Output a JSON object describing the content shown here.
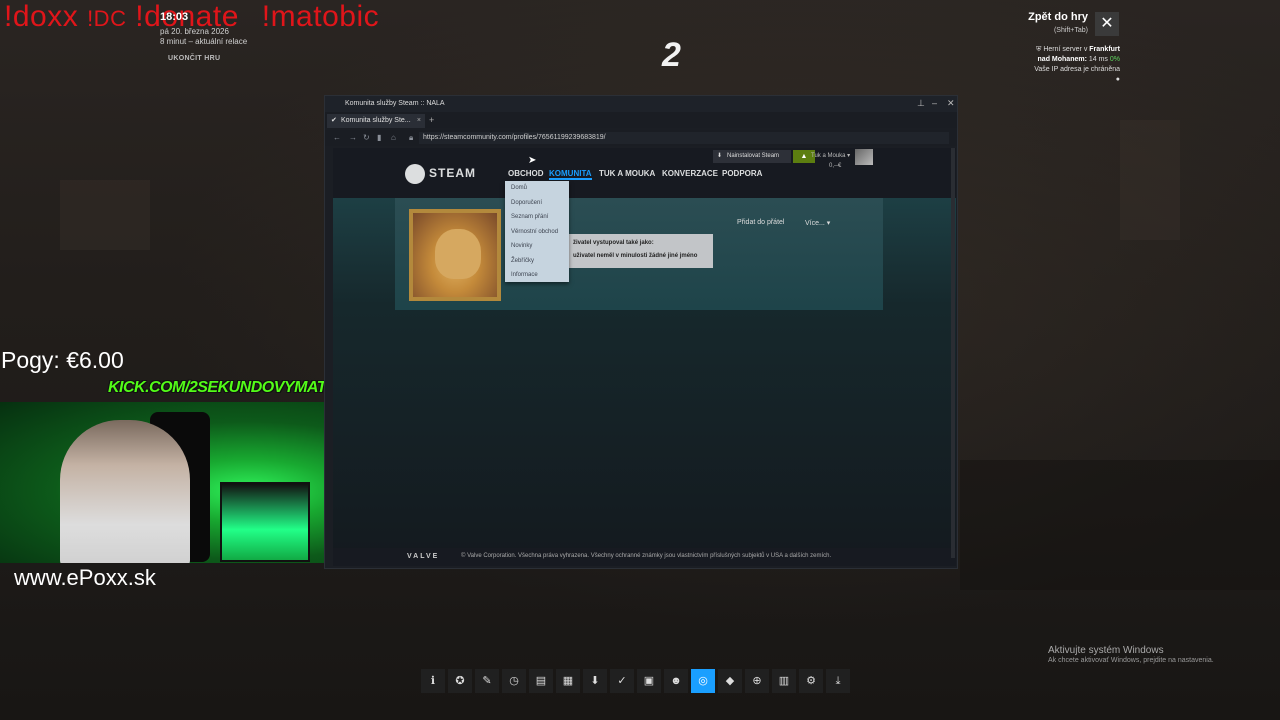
{
  "overlay": {
    "stream_cmds": {
      "doxx": "!doxx",
      "dc": "!DC",
      "donate": "!donate",
      "matobic": "!matobic"
    },
    "clock": "18:03",
    "date": "pá 20. března 2026",
    "session": "8 minut – aktuální relace",
    "end_game": "UKONČIT HRU",
    "back_to_game": "Zpět do hry",
    "back_hint": "(Shift+Tab)",
    "close_icon": "✕",
    "server": {
      "line1_prefix": "Herní server v ",
      "line1_city": "Frankfurt",
      "line2_city": "nad Mohanem:",
      "line2_ping": " 14 ms ",
      "line2_loss": "0%",
      "line3": "Vaše IP adresa je chráněna"
    },
    "pogy": "Pogy: €6.00",
    "kick": "KICK.COM/2SEKUNDOVYMATO",
    "website": "www.ePoxx.sk",
    "cs2_logo": "2",
    "windows_activate": "Aktivujte systém Windows",
    "windows_activate_sub": "Ak chcete aktivovať Windows, prejdite na nastavenia."
  },
  "toolbar": {
    "icons": [
      {
        "name": "info-icon",
        "glyph": "ℹ"
      },
      {
        "name": "achievements-icon",
        "glyph": "✪"
      },
      {
        "name": "edit-icon",
        "glyph": "✎"
      },
      {
        "name": "clock-icon",
        "glyph": "◷"
      },
      {
        "name": "notes-icon",
        "glyph": "▤"
      },
      {
        "name": "chat-icon",
        "glyph": "▦"
      },
      {
        "name": "download-icon",
        "glyph": "⬇"
      },
      {
        "name": "wrench-icon",
        "glyph": "✓"
      },
      {
        "name": "screenshot-icon",
        "glyph": "▣"
      },
      {
        "name": "friends-icon",
        "glyph": "☻"
      },
      {
        "name": "browser-icon",
        "glyph": "◎"
      },
      {
        "name": "controller-icon",
        "glyph": "◆"
      },
      {
        "name": "globe-icon",
        "glyph": "⊕"
      },
      {
        "name": "recording-icon",
        "glyph": "▥"
      },
      {
        "name": "settings-icon",
        "glyph": "⚙"
      },
      {
        "name": "minimize-icon",
        "glyph": "⤓"
      }
    ],
    "active_index": 10
  },
  "browser": {
    "window_title": "Komunita služby Steam :: NALA",
    "tab_label": "Komunita služby Ste...",
    "tab_close": "×",
    "new_tab": "+",
    "url": "https://steamcommunity.com/profiles/76561199239683819/",
    "win_min": "–",
    "win_close": "✕",
    "win_pin": "⊥"
  },
  "steam": {
    "logo": "STEAM",
    "nav": {
      "store": "OBCHOD",
      "community": "KOMUNITA",
      "user": "TUK A MOUKA",
      "chat": "KONVERZACE",
      "support": "PODPORA"
    },
    "install": "Nainstalovat Steam",
    "notif": "▲",
    "account": "Tuk a Mouka ▾",
    "wallet": "0,--€",
    "add_friend": "Přidat do přátel",
    "more": "Více... ▾",
    "tooltip": {
      "line1": "živatel vystupoval také jako:",
      "line2": "uživatel neměl v minulosti žádné jiné jméno"
    },
    "dropdown": [
      "Domů",
      "Doporučení",
      "Seznam přání",
      "Věrnostní obchod",
      "Novinky",
      "Žebříčky",
      "Informace"
    ],
    "footer_valve": "VALVE",
    "footer_copyright": "© Valve Corporation. Všechna práva vyhrazena. Všechny ochranné známky jsou vlastnictvím příslušných subjektů v USA a dalších zemích."
  }
}
